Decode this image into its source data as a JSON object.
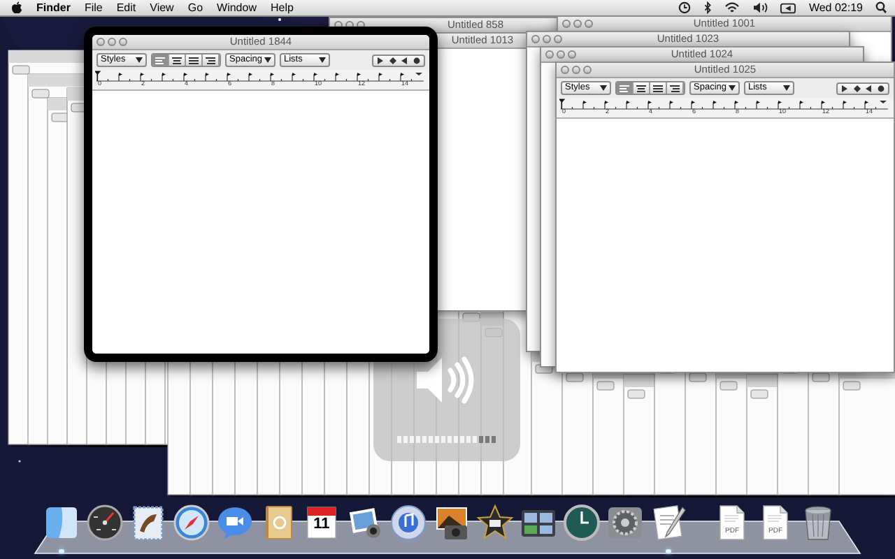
{
  "menu_bar": {
    "app_name": "Finder",
    "menus": [
      "File",
      "Edit",
      "View",
      "Go",
      "Window",
      "Help"
    ],
    "clock": "Wed 02:19"
  },
  "windows": [
    {
      "title": "Untitled 858",
      "selected": false
    },
    {
      "title": "Untitled 1013",
      "selected": false
    },
    {
      "title": "Untitled 1001",
      "selected": false
    },
    {
      "title": "Untitled 1023",
      "selected": false
    },
    {
      "title": "Untitled 1024",
      "selected": false
    },
    {
      "title": "Untitled 1025",
      "selected": false,
      "toolbar": {
        "styles": "Styles",
        "alignment": [
          {
            "selected": true
          },
          {
            "selected": false
          },
          {
            "selected": false
          },
          {
            "selected": false
          }
        ],
        "spacing": "Spacing",
        "lists": "Lists"
      },
      "ruler": [
        "0",
        "2",
        "4",
        "6",
        "8",
        "10",
        "12",
        "14"
      ]
    },
    {
      "title": "Untitled 1844",
      "selected": true,
      "toolbar": {
        "styles": "Styles",
        "alignment": [
          {
            "selected": true
          },
          {
            "selected": false
          },
          {
            "selected": false
          },
          {
            "selected": false
          }
        ],
        "spacing": "Spacing",
        "lists": "Lists"
      },
      "ruler": [
        "0",
        "2",
        "4",
        "6",
        "8",
        "10",
        "12",
        "14"
      ]
    }
  ],
  "volume_hud": {
    "level": 0.81
  },
  "dock": [
    {
      "kind": "finder",
      "running": true
    },
    {
      "kind": "dashboard",
      "running": false
    },
    {
      "kind": "mail",
      "running": false
    },
    {
      "kind": "safari",
      "running": false
    },
    {
      "kind": "chat",
      "running": false
    },
    {
      "kind": "contacts",
      "running": false
    },
    {
      "kind": "calendar",
      "label": "11",
      "running": false
    },
    {
      "kind": "photos",
      "running": false
    },
    {
      "kind": "music",
      "running": false
    },
    {
      "kind": "camera",
      "running": false
    },
    {
      "kind": "movie",
      "running": false
    },
    {
      "kind": "spaces",
      "running": false
    },
    {
      "kind": "backup",
      "running": false
    },
    {
      "kind": "settings",
      "running": false
    },
    {
      "kind": "textedit",
      "running": true
    },
    {
      "kind": "pdf",
      "label": "PDF",
      "running": false
    },
    {
      "kind": "pdf",
      "label": "PDF",
      "running": false
    },
    {
      "kind": "trash",
      "running": false
    }
  ]
}
